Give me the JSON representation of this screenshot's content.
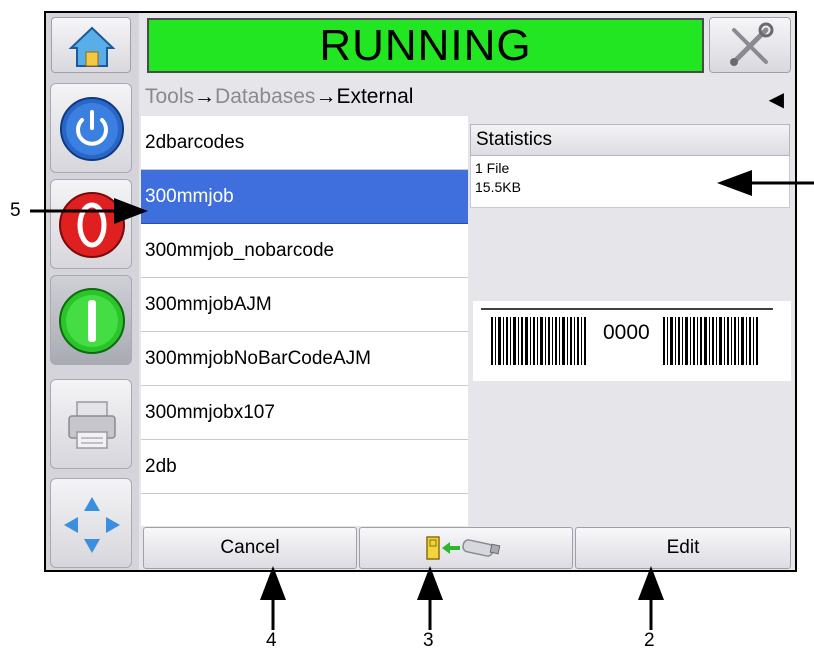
{
  "header": {
    "status": "RUNNING",
    "status_color": "#22e622"
  },
  "breadcrumb": {
    "part1": "Tools",
    "sep1": "→",
    "part2": "Databases",
    "sep2": "→",
    "part3": "External",
    "back_glyph": "◀"
  },
  "left_bar": {
    "items": [
      {
        "icon": "home-icon"
      },
      {
        "icon": "power-icon"
      },
      {
        "icon": "stop-icon"
      },
      {
        "icon": "start-icon"
      },
      {
        "icon": "printer-icon"
      },
      {
        "icon": "navigate-icon"
      }
    ]
  },
  "database_list": {
    "items": [
      {
        "label": "2dbarcodes",
        "selected": false
      },
      {
        "label": "300mmjob",
        "selected": true
      },
      {
        "label": "300mmjob_nobarcode",
        "selected": false
      },
      {
        "label": "300mmjobAJM",
        "selected": false
      },
      {
        "label": "300mmjobNoBarCodeAJM",
        "selected": false
      },
      {
        "label": "300mmjobx107",
        "selected": false
      },
      {
        "label": "2db",
        "selected": false
      }
    ]
  },
  "statistics": {
    "title": "Statistics",
    "files": "1 File",
    "size": "15.5KB"
  },
  "preview": {
    "barcode_text": "0000"
  },
  "footer": {
    "cancel_label": "Cancel",
    "transfer_icon": "usb-transfer-icon",
    "edit_label": "Edit"
  },
  "annotations": {
    "callout_5": "5",
    "callout_4": "4",
    "callout_3": "3",
    "callout_2": "2"
  }
}
